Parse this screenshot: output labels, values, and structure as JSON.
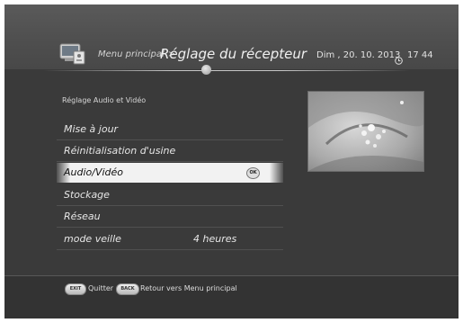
{
  "header": {
    "breadcrumb_parent": "Menu principal",
    "separator": ">",
    "title": "Réglage du récepteur",
    "date": "Dim , 20. 10. 2013",
    "time": "17 44",
    "icon": "receiver-settings-icon",
    "clock_icon": "clock-icon"
  },
  "section_label": "Réglage Audio et Vidéo",
  "menu": {
    "items": [
      {
        "label": "Mise à jour",
        "value": ""
      },
      {
        "label": "Réinitialisation d'usine",
        "value": ""
      },
      {
        "label": "Audio/Vidéo",
        "value": "",
        "selected": true,
        "ok_label": "OK"
      },
      {
        "label": "Stockage",
        "value": ""
      },
      {
        "label": "Réseau",
        "value": ""
      },
      {
        "label": "mode veille",
        "value": "4 heures"
      }
    ]
  },
  "footer": {
    "exit_key": "EXIT",
    "exit_label": "Quitter",
    "back_key": "BACK",
    "back_label": "Retour vers Menu principal"
  },
  "colors": {
    "background": "#3a3a3a",
    "highlight": "#f2f2f2",
    "text": "#e6e6e6"
  }
}
